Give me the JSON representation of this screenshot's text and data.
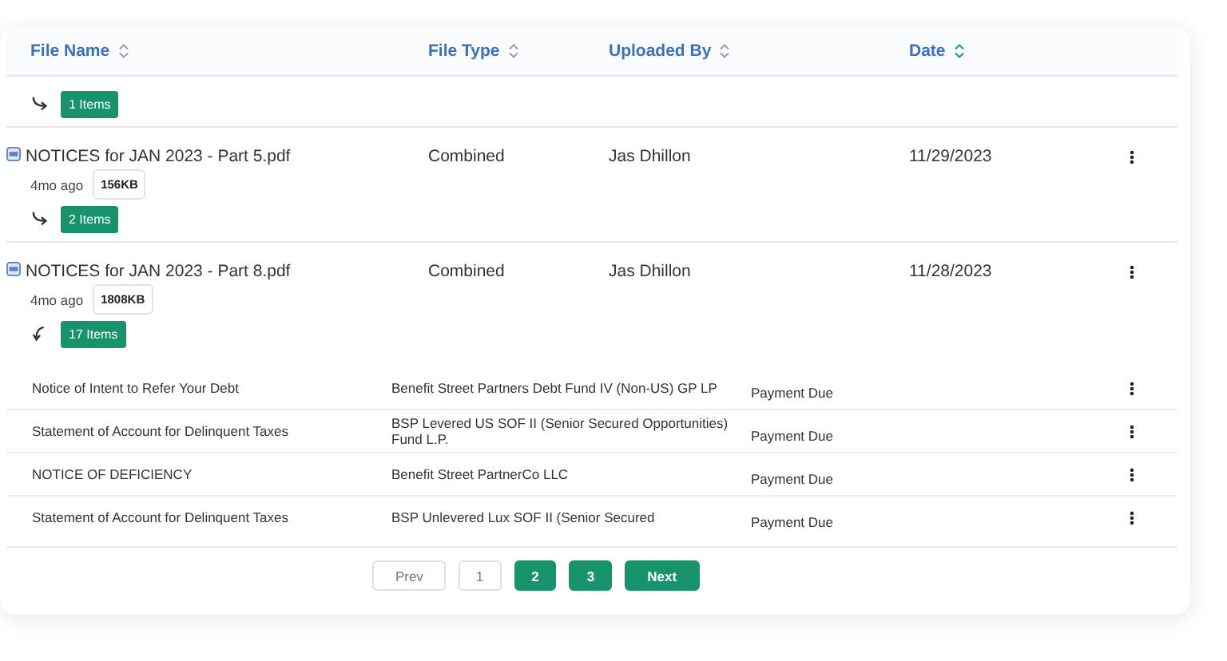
{
  "columns": [
    {
      "label": "File Name",
      "sorted": false
    },
    {
      "label": "File Type",
      "sorted": false
    },
    {
      "label": "Uploaded By",
      "sorted": false
    },
    {
      "label": "Date",
      "sorted": true
    }
  ],
  "files": [
    {
      "items_label": "1 Items",
      "expanded": false
    },
    {
      "name": "NOTICES for JAN 2023 - Part 5.pdf",
      "age": "4mo ago",
      "size": "156KB",
      "type": "Combined",
      "uploaded_by": "Jas Dhillon",
      "date": "11/29/2023",
      "items_label": "2 Items",
      "expanded": false
    },
    {
      "name": "NOTICES for JAN 2023 - Part 8.pdf",
      "age": "4mo ago",
      "size": "1808KB",
      "type": "Combined",
      "uploaded_by": "Jas Dhillon",
      "date": "11/28/2023",
      "items_label": "17 Items",
      "expanded": true,
      "children": [
        {
          "title": "Notice of Intent to Refer Your Debt",
          "entity": "Benefit Street Partners Debt Fund IV (Non-US) GP LP",
          "status": "Payment Due"
        },
        {
          "title": "Statement of Account for Delinquent Taxes",
          "entity": "BSP Levered US SOF II (Senior Secured Opportunities) Fund L.P.",
          "status": "Payment Due"
        },
        {
          "title": "NOTICE OF DEFICIENCY",
          "entity": "Benefit Street PartnerCo LLC",
          "status": "Payment Due"
        },
        {
          "title": "Statement of Account for Delinquent Taxes",
          "entity": "BSP Unlevered Lux SOF II (Senior Secured",
          "status": "Payment Due"
        }
      ]
    }
  ],
  "pagination": {
    "prev": {
      "label": "Prev",
      "disabled": true
    },
    "pages": [
      {
        "label": "1",
        "selected": true
      },
      {
        "label": "2",
        "selected": false
      },
      {
        "label": "3",
        "selected": false
      }
    ],
    "next": {
      "label": "Next",
      "disabled": false
    }
  }
}
